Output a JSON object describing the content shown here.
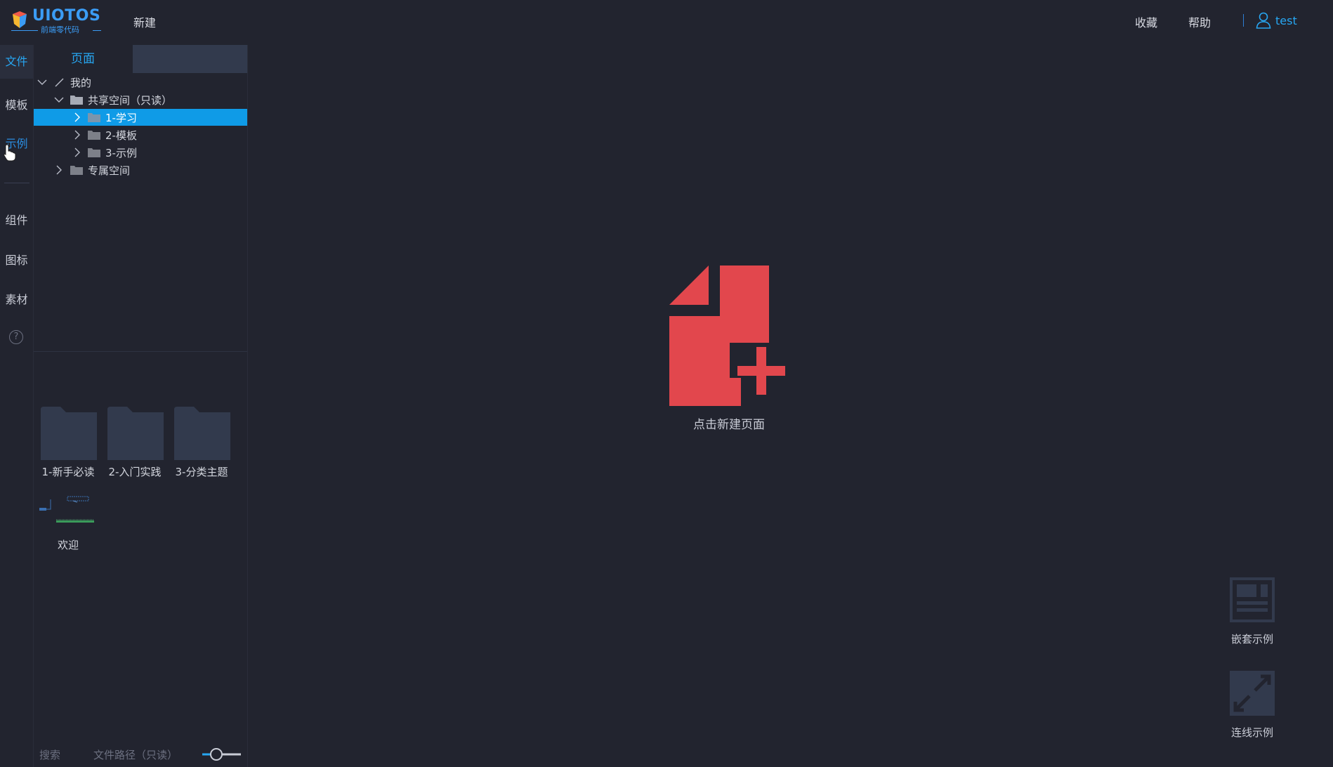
{
  "header": {
    "logo_text": "UIOTOS",
    "logo_subtitle": "前端零代码",
    "new_label": "新建",
    "favorites_label": "收藏",
    "help_label": "帮助",
    "user_name": "test"
  },
  "rail": {
    "items": [
      {
        "label": "文件",
        "active": true
      },
      {
        "label": "模板",
        "active": false
      },
      {
        "label": "示例",
        "active": false
      },
      {
        "label": "组件",
        "active": false
      },
      {
        "label": "图标",
        "active": false
      },
      {
        "label": "素材",
        "active": false
      }
    ],
    "help_icon": "?"
  },
  "panel": {
    "tab_page_label": "页面",
    "tree": [
      {
        "label": "我的",
        "expanded": true,
        "level": 0
      },
      {
        "label": "共享空间（只读）",
        "expanded": true,
        "level": 1
      },
      {
        "label": "1-学习",
        "expanded": false,
        "level": 2,
        "selected": true
      },
      {
        "label": "2-模板",
        "expanded": false,
        "level": 2
      },
      {
        "label": "3-示例",
        "expanded": false,
        "level": 2
      },
      {
        "label": "专属空间",
        "expanded": false,
        "level": 1
      }
    ],
    "thumbnails": [
      {
        "label": "1-新手必读"
      },
      {
        "label": "2-入门实践"
      },
      {
        "label": "3-分类主题"
      }
    ],
    "welcome_label": "欢迎",
    "search_placeholder": "搜索",
    "path_placeholder": "文件路径（只读）"
  },
  "main": {
    "new_page_label": "点击新建页面",
    "nested_example_label": "嵌套示例",
    "connect_example_label": "连线示例"
  },
  "colors": {
    "background": "#22242f",
    "accent": "#27a7f3",
    "selected_row": "#0f9be7",
    "new_page_red": "#e2474d"
  }
}
